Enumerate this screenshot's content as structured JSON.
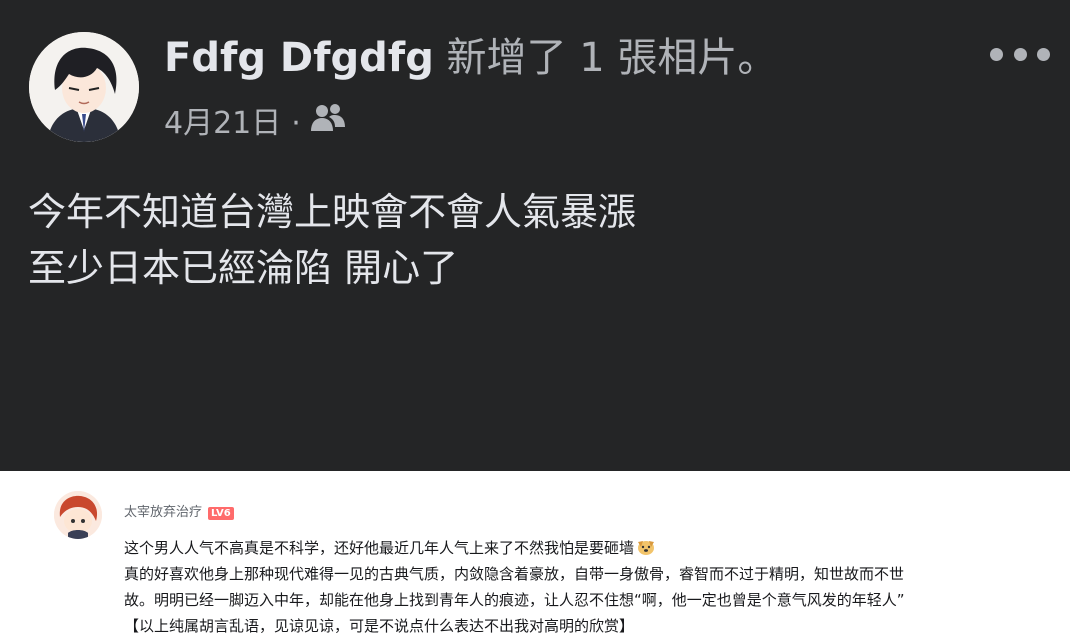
{
  "post": {
    "author_name": "Fdfg Dfgdfg",
    "action_text": "新增了 1 張相片。",
    "date": "4月21日",
    "separator": "·",
    "audience_icon": "friends-icon",
    "more_icon": "more-options-icon",
    "text_lines": [
      "今年不知道台灣上映會不會人氣暴漲",
      "至少日本已經淪陷 開心了"
    ]
  },
  "comment": {
    "username": "太宰放弃治疗",
    "level_badge": "LV6",
    "emoji_icon": "dog-face-emoji",
    "lines": [
      "这个男人人气不高真是不科学，还好他最近几年人气上来了不然我怕是要砸墙",
      "真的好喜欢他身上那种现代难得一见的古典气质，内敛隐含着豪放，自带一身傲骨，睿智而不过于精明，知世故而不世",
      "故。明明已经一脚迈入中年，却能在他身上找到青年人的痕迹，让人忍不住想“啊，他一定也曾是个意气风发的年轻人”",
      "【以上纯属胡言乱语，见谅见谅，可是不说点什么表达不出我对高明的欣赏】"
    ]
  },
  "colors": {
    "post_background": "#242526",
    "primary_text": "#e4e6eb",
    "secondary_text": "#b0b3b8",
    "comment_background": "#ffffff",
    "comment_text": "#18191c",
    "level_badge": "#ff6b6b"
  }
}
